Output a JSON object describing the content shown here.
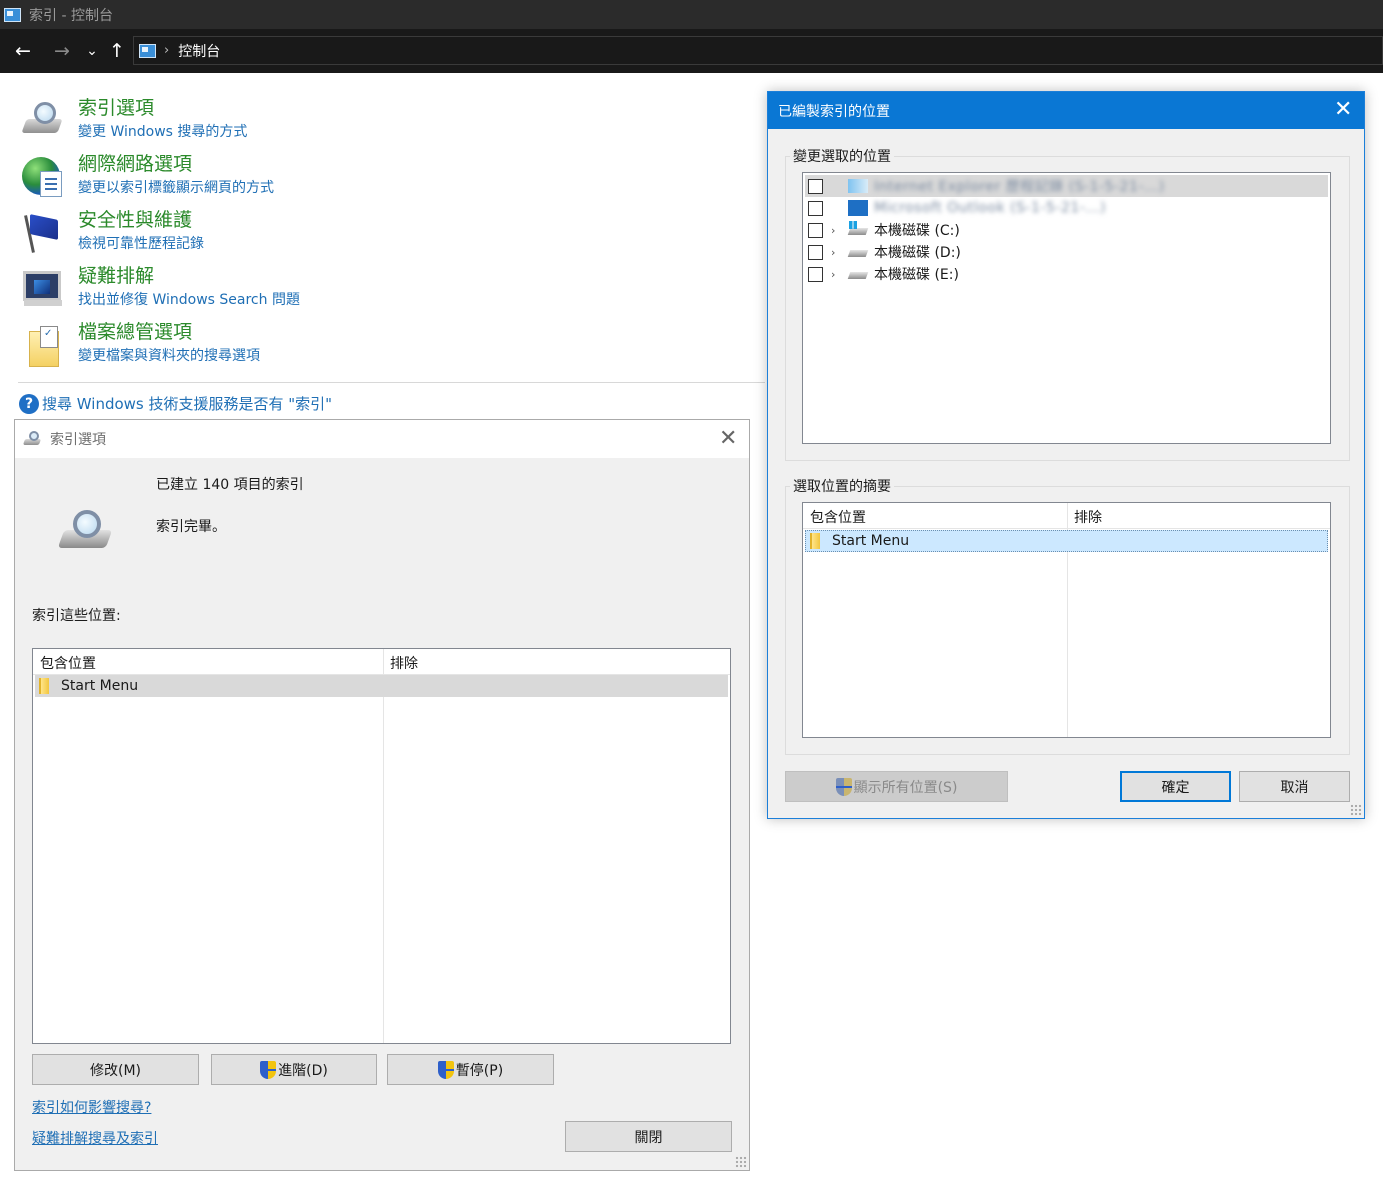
{
  "window": {
    "title": "索引 - 控制台"
  },
  "nav": {
    "back": "←",
    "forward": "→",
    "recent": "⌄",
    "up": "↑",
    "separator": "›",
    "breadcrumb": "控制台"
  },
  "control_panel": {
    "items": [
      {
        "title": "索引選項",
        "subtitle": "變更 Windows 搜尋的方式",
        "icon": "indexing-options-icon"
      },
      {
        "title": "網際網路選項",
        "subtitle": "變更以索引標籤顯示網頁的方式",
        "icon": "internet-options-icon"
      },
      {
        "title": "安全性與維護",
        "subtitle": "檢視可靠性歷程記錄",
        "icon": "security-maintenance-flag-icon"
      },
      {
        "title": "疑難排解",
        "subtitle": "找出並修復 Windows Search 問題",
        "icon": "troubleshooting-icon"
      },
      {
        "title": "檔案總管選項",
        "subtitle": "變更檔案與資料夾的搜尋選項",
        "icon": "file-explorer-options-icon"
      }
    ],
    "help_link": "搜尋 Windows 技術支援服務是否有 \"索引\"",
    "help_icon": "?"
  },
  "indexing_dialog": {
    "title": "索引選項",
    "status_count": "已建立 140 項目的索引",
    "status_state": "索引完畢。",
    "locations_label": "索引這些位置:",
    "columns": {
      "included": "包含位置",
      "excluded": "排除"
    },
    "rows": [
      {
        "included": "Start Menu",
        "excluded": ""
      }
    ],
    "buttons": {
      "modify": "修改(M)",
      "advanced": "進階(D)",
      "pause": "暫停(P)",
      "close": "關閉"
    },
    "links": {
      "how_affects": "索引如何影響搜尋?",
      "troubleshoot": "疑難排解搜尋及索引"
    },
    "close_glyph": "✕"
  },
  "locations_dialog": {
    "title": "已編製索引的位置",
    "change_label": "變更選取的位置",
    "tree": [
      {
        "label": "Internet Explorer 歷程記錄 (S-1-5-21-...)",
        "checked": false,
        "expandable": false,
        "icon": "ie-history-icon"
      },
      {
        "label": "Microsoft Outlook (S-1-5-21-...)",
        "checked": false,
        "expandable": false,
        "icon": "outlook-icon"
      },
      {
        "label": "本機磁碟 (C:)",
        "checked": false,
        "expandable": true,
        "icon": "windows-drive-icon"
      },
      {
        "label": "本機磁碟 (D:)",
        "checked": false,
        "expandable": true,
        "icon": "drive-icon"
      },
      {
        "label": "本機磁碟 (E:)",
        "checked": false,
        "expandable": true,
        "icon": "drive-icon"
      }
    ],
    "summary_label": "選取位置的摘要",
    "columns": {
      "included": "包含位置",
      "excluded": "排除"
    },
    "rows": [
      {
        "included": "Start Menu",
        "excluded": ""
      }
    ],
    "buttons": {
      "show_all": "顯示所有位置(S)",
      "ok": "確定",
      "cancel": "取消"
    },
    "close_glyph": "✕",
    "expand_glyph": "›"
  },
  "colors": {
    "link": "#1f6fb5",
    "item_title": "#2b8a2b",
    "dialog_title_active": "#0a77d4",
    "selection": "#cce8ff"
  }
}
